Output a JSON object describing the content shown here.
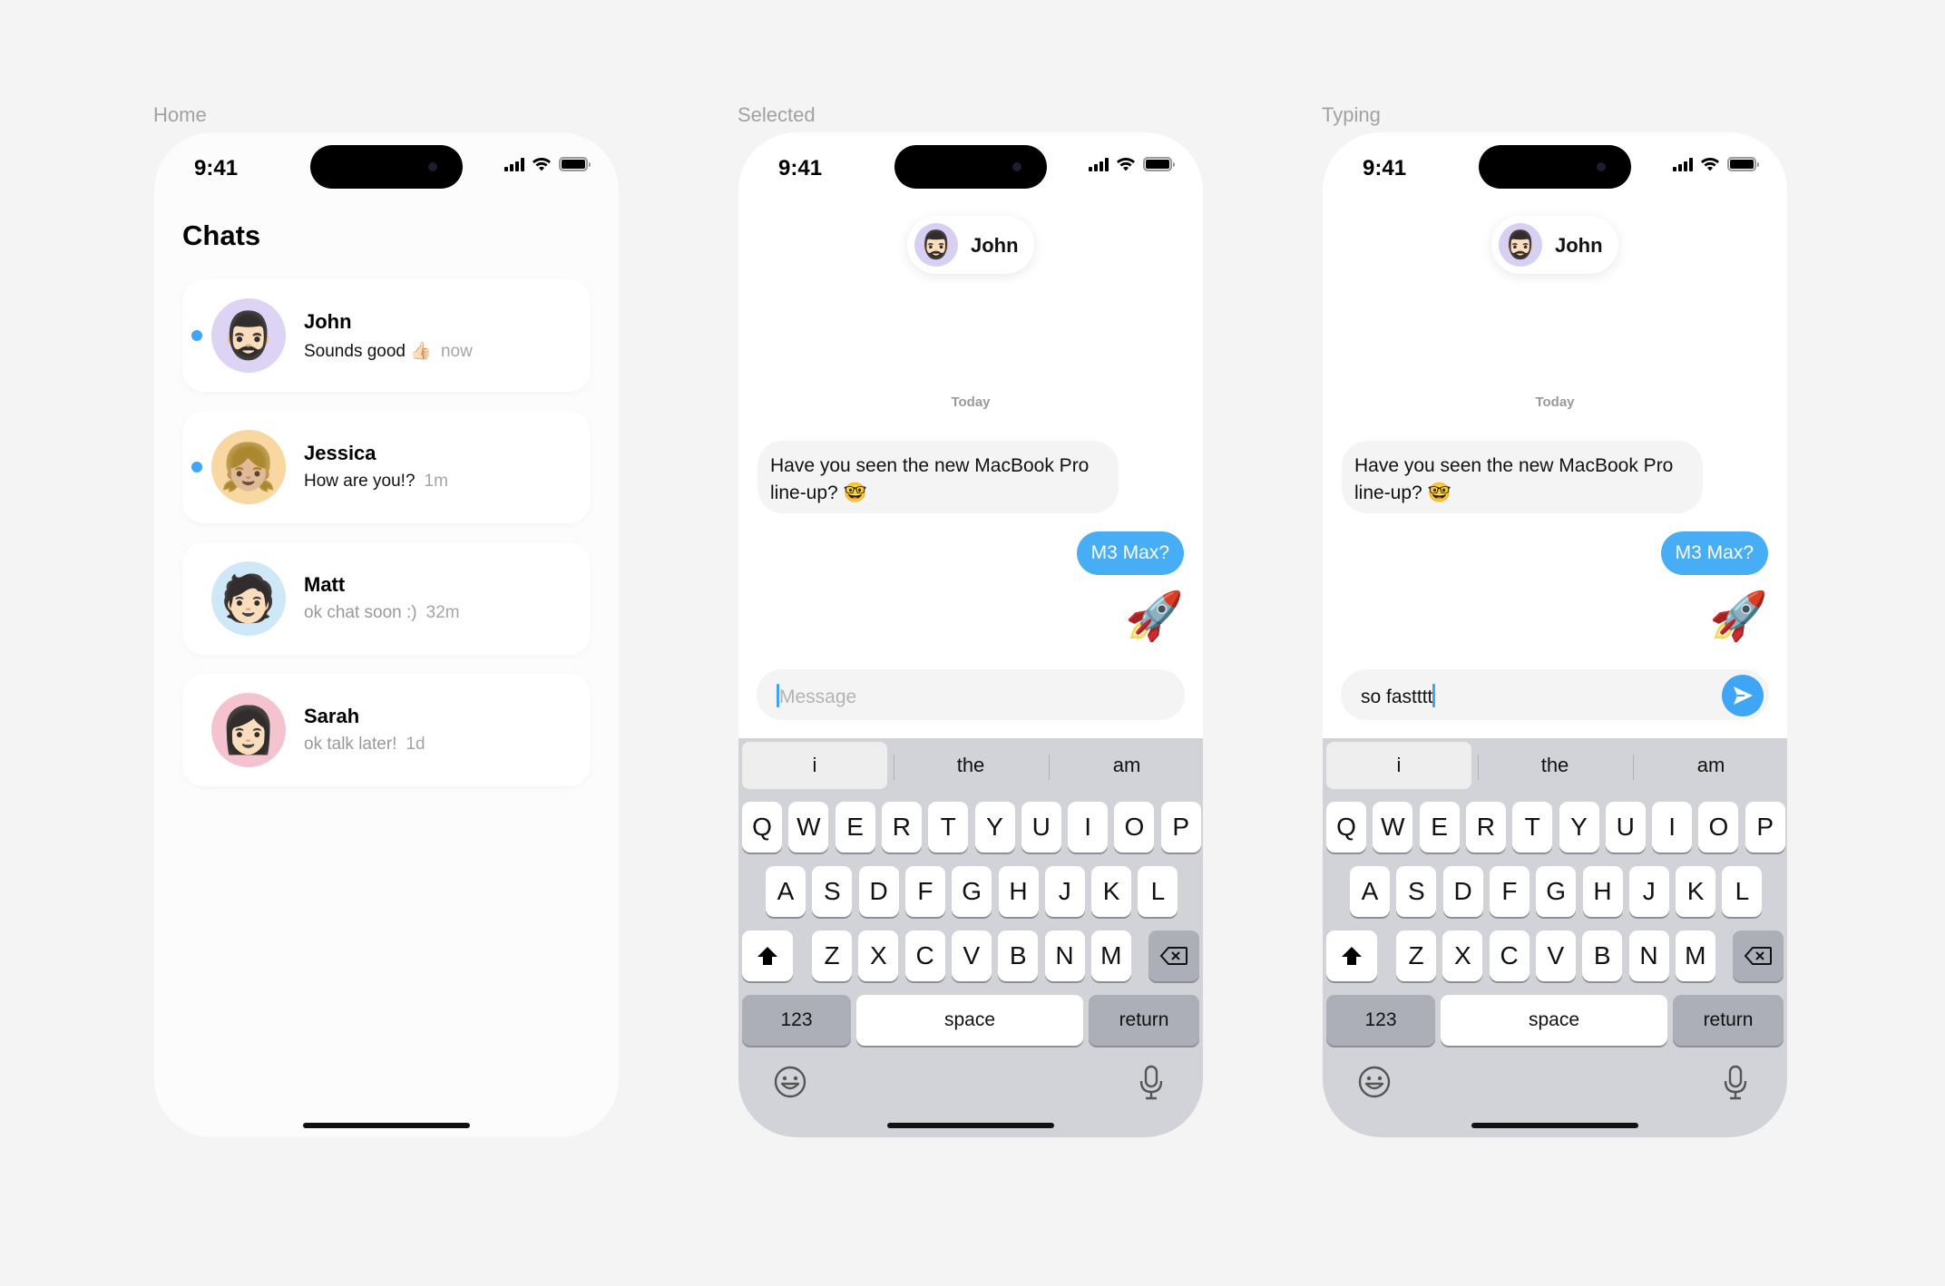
{
  "labels": {
    "home": "Home",
    "selected": "Selected",
    "typing": "Typing"
  },
  "status": {
    "time": "9:41"
  },
  "home": {
    "title": "Chats",
    "chats": [
      {
        "name": "John",
        "message": "Sounds good 👍🏻",
        "time": "now",
        "unread": true,
        "avatar": "🧔🏻‍♂️",
        "avatar_bg": "#ddd3f4"
      },
      {
        "name": "Jessica",
        "message": "How are you!?",
        "time": "1m",
        "unread": true,
        "avatar": "👧🏼",
        "avatar_bg": "#f8d7a0"
      },
      {
        "name": "Matt",
        "message": "ok chat soon :)",
        "time": "32m",
        "unread": false,
        "avatar": "🧑🏻",
        "avatar_bg": "#cfe8f7"
      },
      {
        "name": "Sarah",
        "message": "ok talk later!",
        "time": "1d",
        "unread": false,
        "avatar": "👩🏻",
        "avatar_bg": "#f5c3cf"
      }
    ]
  },
  "conversation": {
    "contact_name": "John",
    "contact_avatar": "🧔🏻‍♂️",
    "day": "Today",
    "incoming": "Have you seen the new MacBook Pro line-up? 🤓",
    "outgoing": "M3 Max?",
    "emoji_reply": "🚀"
  },
  "composer": {
    "placeholder": "Message",
    "typed": "so fastttt"
  },
  "keyboard": {
    "suggestions": [
      "i",
      "the",
      "am"
    ],
    "row1": [
      "Q",
      "W",
      "E",
      "R",
      "T",
      "Y",
      "U",
      "I",
      "O",
      "P"
    ],
    "row2": [
      "A",
      "S",
      "D",
      "F",
      "G",
      "H",
      "J",
      "K",
      "L"
    ],
    "row3": [
      "Z",
      "X",
      "C",
      "V",
      "B",
      "N",
      "M"
    ],
    "numbers": "123",
    "space": "space",
    "return": "return"
  },
  "colors": {
    "accent": "#3ea6f5",
    "bubble_out": "#47aef5",
    "keyboard_bg": "#d2d3d8"
  },
  "icons": [
    "signal-icon",
    "wifi-icon",
    "battery-icon",
    "shift-icon",
    "delete-icon",
    "emoji-icon",
    "microphone-icon",
    "send-icon"
  ]
}
